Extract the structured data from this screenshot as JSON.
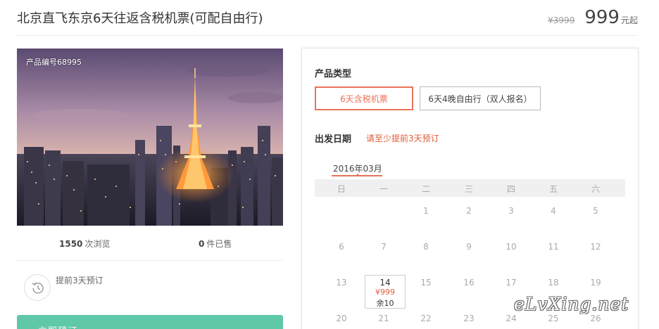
{
  "header": {
    "title": "北京直飞东京6天往返含税机票(可配自由行)",
    "old_price": "¥3999",
    "price": "999",
    "price_unit": "元起"
  },
  "gallery": {
    "image_description": "Tokyo Tower lit at dusk over city skyline",
    "product_no": "产品编号68995"
  },
  "stats": {
    "views_count": "1550",
    "views_label": "次浏览",
    "sold_count": "0",
    "sold_label": "件已售"
  },
  "booking_note": {
    "icon": "clock-icon",
    "text": "提前3天预订"
  },
  "book_button": {
    "label": "立即预订",
    "color": "#5fc8a8"
  },
  "product_type": {
    "label": "产品类型",
    "options": [
      {
        "label": "6天含税机票",
        "selected": true
      },
      {
        "label": "6天4晚自由行（双人报名）",
        "selected": false
      }
    ]
  },
  "departure": {
    "label": "出发日期",
    "hint": "请至少提前3天预订",
    "month": "2016年03月",
    "weekdays": [
      "日",
      "一",
      "二",
      "三",
      "四",
      "五",
      "六"
    ],
    "rows": [
      [
        "",
        "",
        "1",
        "2",
        "3",
        "4",
        "5"
      ],
      [
        "6",
        "7",
        "8",
        "9",
        "10",
        "11",
        "12"
      ],
      [
        "13",
        "14",
        "15",
        "16",
        "17",
        "18",
        "19"
      ],
      [
        "20",
        "21",
        "22",
        "23",
        "24",
        "25",
        "26"
      ]
    ],
    "available": {
      "day": "14",
      "price": "¥999",
      "stock": "余10"
    }
  },
  "watermark": "eLvXing.net",
  "colors": {
    "accent": "#e8735a",
    "hint": "#e15d3b",
    "book": "#5fc8a8"
  }
}
